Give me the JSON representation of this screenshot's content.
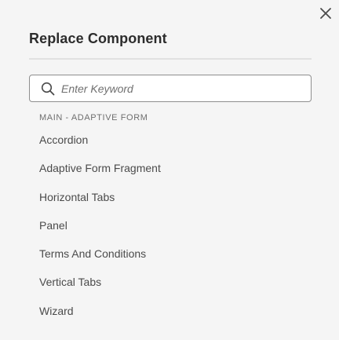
{
  "dialog": {
    "title": "Replace Component",
    "close_icon": "close-icon"
  },
  "search": {
    "placeholder": "Enter Keyword",
    "value": "",
    "icon": "search-icon"
  },
  "group": {
    "header": "MAIN - ADAPTIVE FORM",
    "items": [
      {
        "label": "Accordion"
      },
      {
        "label": "Adaptive Form Fragment"
      },
      {
        "label": "Horizontal Tabs"
      },
      {
        "label": "Panel"
      },
      {
        "label": "Terms And Conditions"
      },
      {
        "label": "Vertical Tabs"
      },
      {
        "label": "Wizard"
      }
    ]
  },
  "colors": {
    "background": "#f5f5f5",
    "input_border": "#8e8e8e",
    "text": "#4b4b4b",
    "header_text": "#6e6e6e"
  }
}
